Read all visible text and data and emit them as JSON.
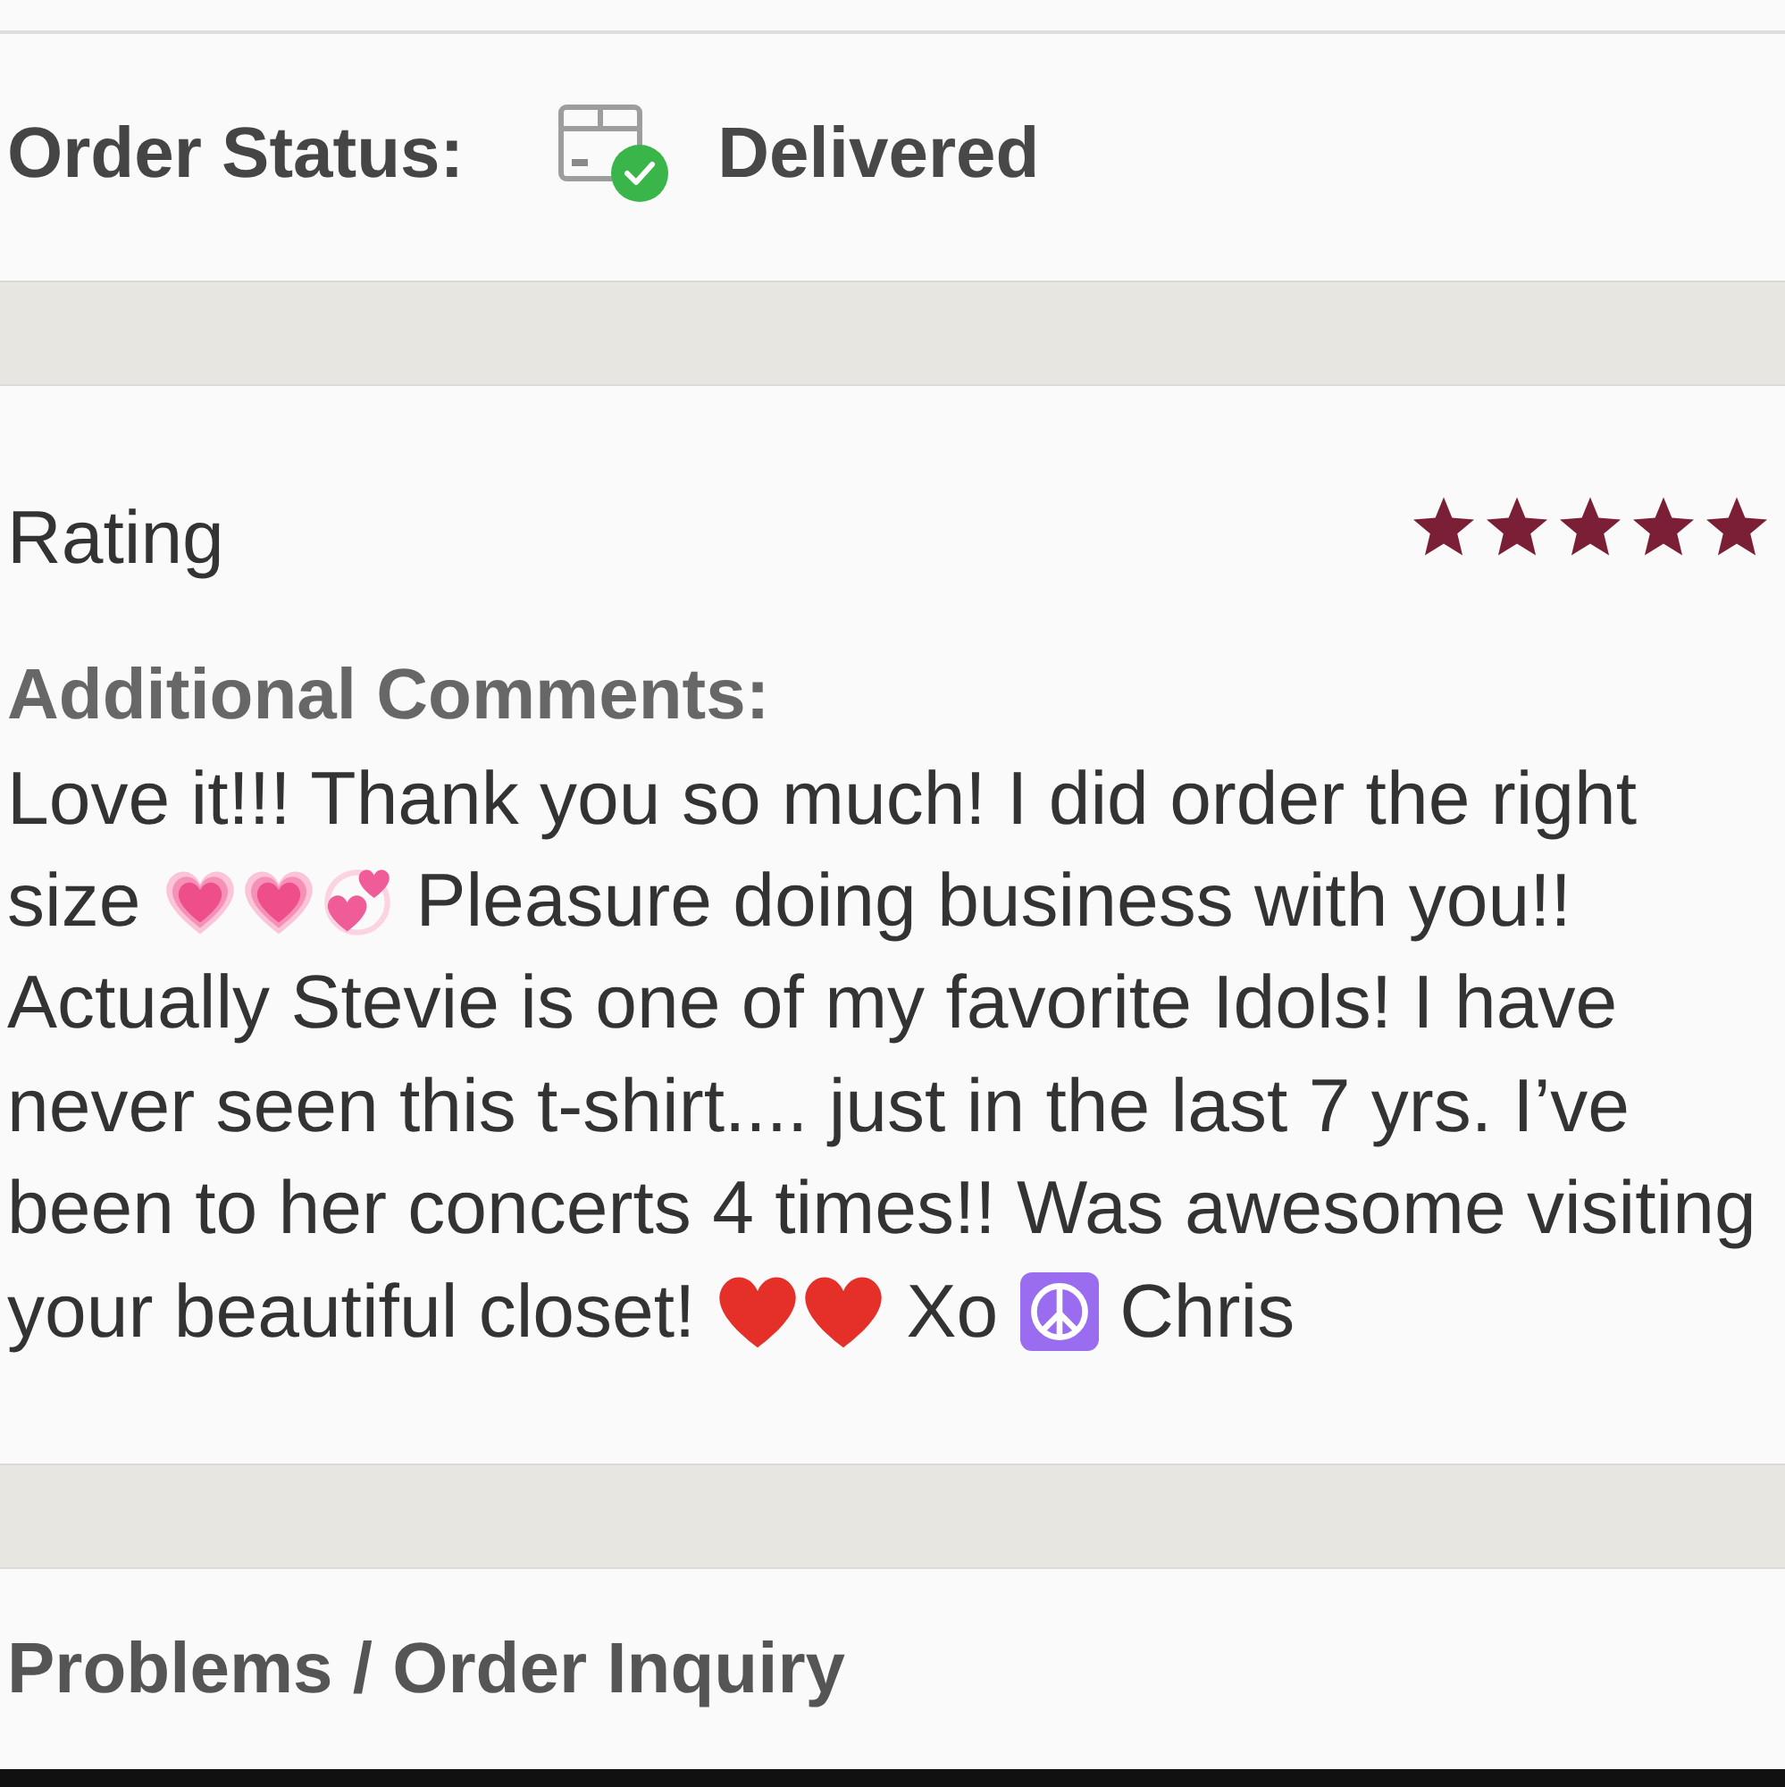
{
  "order_status": {
    "label": "Order Status:",
    "value": "Delivered"
  },
  "rating": {
    "label": "Rating",
    "stars": 5
  },
  "comments": {
    "label": "Additional Comments:",
    "lines": [
      [
        {
          "kind": "text",
          "text": "Love it!!! Thank you so much! I did order the right"
        }
      ],
      [
        {
          "kind": "text",
          "text": "size"
        },
        {
          "kind": "growing-heart"
        },
        {
          "kind": "growing-heart"
        },
        {
          "kind": "two-hearts"
        },
        {
          "kind": "text",
          "text": "Pleasure doing business with you!!"
        }
      ],
      [
        {
          "kind": "text",
          "text": "Actually Stevie is one of my favorite Idols! I have"
        }
      ],
      [
        {
          "kind": "text",
          "text": "never seen this t-shirt.... just in the last 7 yrs. I’ve"
        }
      ],
      [
        {
          "kind": "text",
          "text": "been to her concerts 4 times!! Was awesome visiting"
        }
      ],
      [
        {
          "kind": "text",
          "text": "your beautiful closet!"
        },
        {
          "kind": "heart"
        },
        {
          "kind": "heart"
        },
        {
          "kind": "text",
          "text": "Xo"
        },
        {
          "kind": "peace-sign"
        },
        {
          "kind": "text",
          "text": "Chris"
        }
      ]
    ]
  },
  "inquiry": {
    "label": "Problems / Order Inquiry"
  }
}
